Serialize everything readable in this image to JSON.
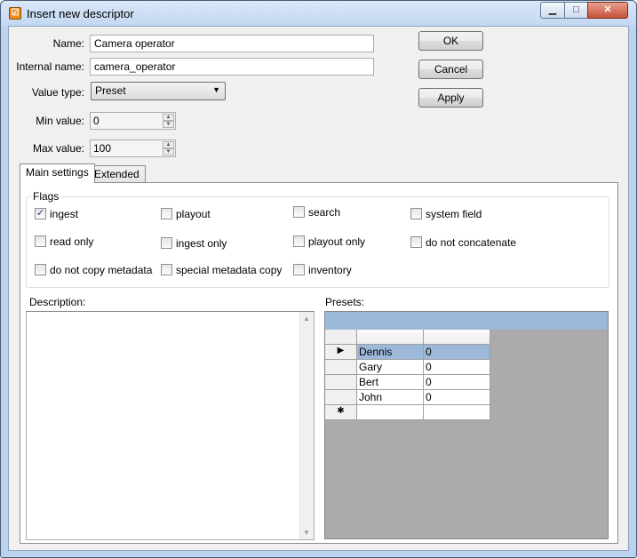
{
  "window": {
    "title": "Insert new descriptor",
    "app_icon_glyph": "☑",
    "min_glyph": "▁",
    "max_glyph": "□",
    "close_glyph": "✕"
  },
  "form": {
    "name_label": "Name:",
    "name_value": "Camera operator",
    "internal_name_label": "Internal name:",
    "internal_name_value": "camera_operator",
    "value_type_label": "Value type:",
    "value_type_value": "Preset",
    "min_value_label": "Min value:",
    "min_value": "0",
    "max_value_label": "Max value:",
    "max_value": "100"
  },
  "buttons": {
    "ok": "OK",
    "cancel": "Cancel",
    "apply": "Apply"
  },
  "tabs": [
    {
      "label": "Main settings",
      "active": true
    },
    {
      "label": "Extended",
      "active": false
    }
  ],
  "flags": {
    "title": "Flags",
    "items": [
      {
        "label": "ingest",
        "checked": true
      },
      {
        "label": "playout",
        "checked": false
      },
      {
        "label": "search",
        "checked": false
      },
      {
        "label": "system field",
        "checked": false
      },
      {
        "label": "read only",
        "checked": false
      },
      {
        "label": "ingest only",
        "checked": false
      },
      {
        "label": "playout only",
        "checked": false
      },
      {
        "label": "do not concatenate",
        "checked": false
      },
      {
        "label": "do not copy metadata",
        "checked": false
      },
      {
        "label": "special metadata copy",
        "checked": false
      },
      {
        "label": "inventory",
        "checked": false
      }
    ]
  },
  "description": {
    "label": "Description:",
    "value": ""
  },
  "presets": {
    "label": "Presets:",
    "current_row_glyph": "▶",
    "new_row_glyph": "✱",
    "rows": [
      {
        "name": "Dennis",
        "value": "0"
      },
      {
        "name": "Gary",
        "value": "0"
      },
      {
        "name": "Bert",
        "value": "0"
      },
      {
        "name": "John",
        "value": "0"
      }
    ]
  },
  "icons": {
    "checkmark": "✓",
    "dropdown_arrow": "▼",
    "spin_up": "▲",
    "spin_down": "▼"
  }
}
